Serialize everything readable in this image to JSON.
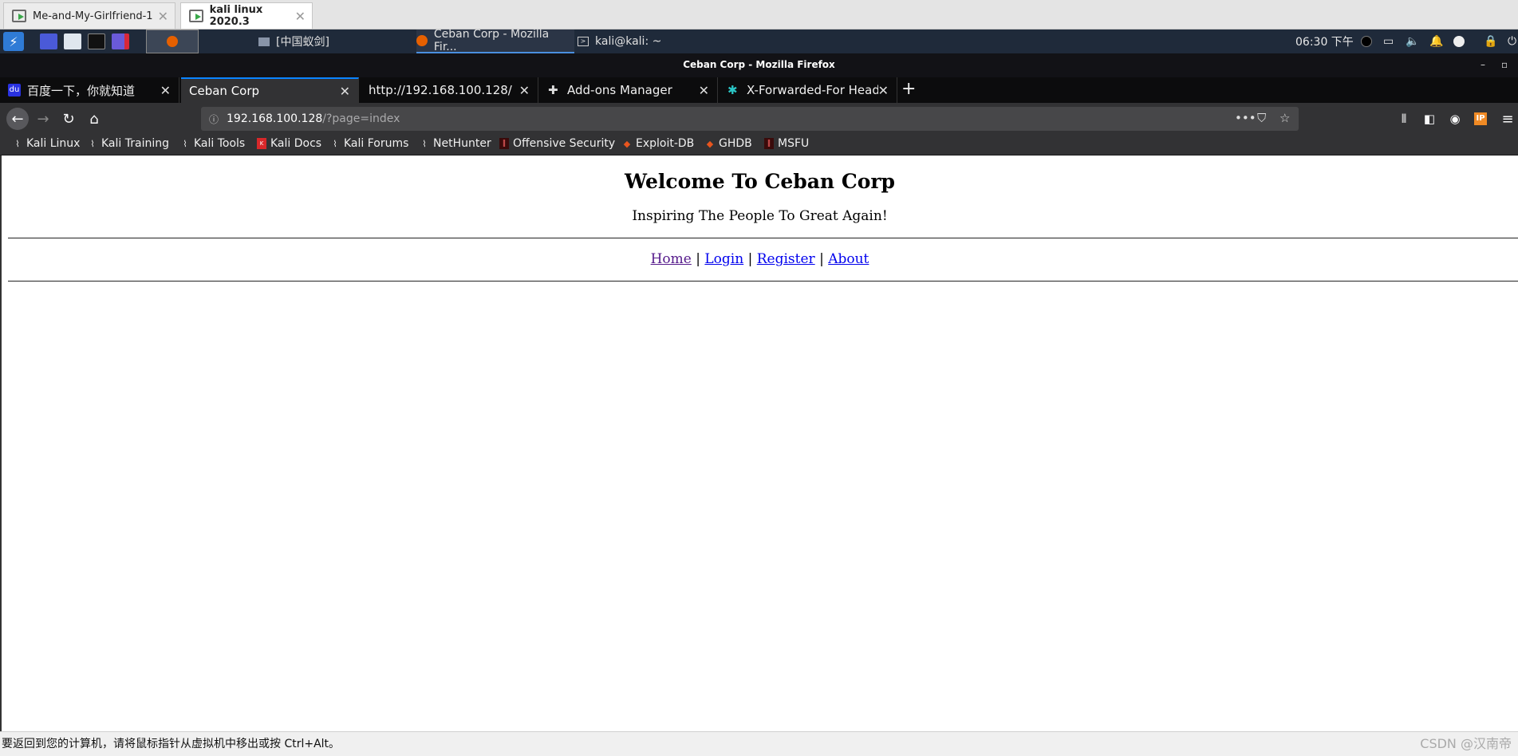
{
  "vmware": {
    "tabs": [
      {
        "label": "Me-and-My-Girlfriend-1",
        "active": false
      },
      {
        "label": "kali linux 2020.3",
        "active": true
      }
    ],
    "status_text": "要返回到您的计算机，请将鼠标指针从虚拟机中移出或按 Ctrl+Alt。",
    "watermark": "CSDN @汉南帝"
  },
  "kali_panel": {
    "tasks": [
      {
        "label": "[中国蚁剑]",
        "icon": "window-icon"
      },
      {
        "label": "Ceban Corp - Mozilla Fir...",
        "icon": "firefox-icon"
      },
      {
        "label": "kali@kali: ~",
        "icon": "terminal-icon"
      }
    ],
    "clock": "06:30 下午"
  },
  "firefox": {
    "window_title": "Ceban Corp - Mozilla Firefox",
    "tabs": [
      {
        "label": "百度一下，你就知道",
        "icon": "baidu-icon",
        "active": false
      },
      {
        "label": "Ceban Corp",
        "icon": "",
        "active": true
      },
      {
        "label": "http://192.168.100.128/",
        "icon": "",
        "active": false
      },
      {
        "label": "Add-ons Manager",
        "icon": "puzzle-icon",
        "active": false
      },
      {
        "label": "X-Forwarded-For Heade",
        "icon": "xff-icon",
        "active": false
      }
    ],
    "url": {
      "host": "192.168.100.128",
      "path": "/?page=index"
    },
    "bookmarks": [
      {
        "label": "Kali Linux",
        "icon": "kali-dragon-icon"
      },
      {
        "label": "Kali Training",
        "icon": "kali-dragon-icon"
      },
      {
        "label": "Kali Tools",
        "icon": "kali-dragon-icon"
      },
      {
        "label": "Kali Docs",
        "icon": "kali-docs-icon"
      },
      {
        "label": "Kali Forums",
        "icon": "kali-dragon-icon"
      },
      {
        "label": "NetHunter",
        "icon": "nethunter-icon"
      },
      {
        "label": "Offensive Security",
        "icon": "offsec-icon"
      },
      {
        "label": "Exploit-DB",
        "icon": "exploitdb-icon"
      },
      {
        "label": "GHDB",
        "icon": "ghdb-icon"
      },
      {
        "label": "MSFU",
        "icon": "msfu-icon"
      }
    ]
  },
  "page": {
    "title": "Welcome To Ceban Corp",
    "tagline": "Inspiring The People To Great Again!",
    "nav": {
      "home": "Home",
      "login": "Login",
      "register": "Register",
      "about": "About",
      "separator": "|"
    }
  },
  "colors": {
    "kali_panel_bg": "#1f2a3a",
    "firefox_dark": "#0c0c0d",
    "firefox_toolbar": "#323234",
    "tab_accent": "#0a84ff",
    "link": "#0000ee",
    "visited_link": "#551a8b"
  }
}
